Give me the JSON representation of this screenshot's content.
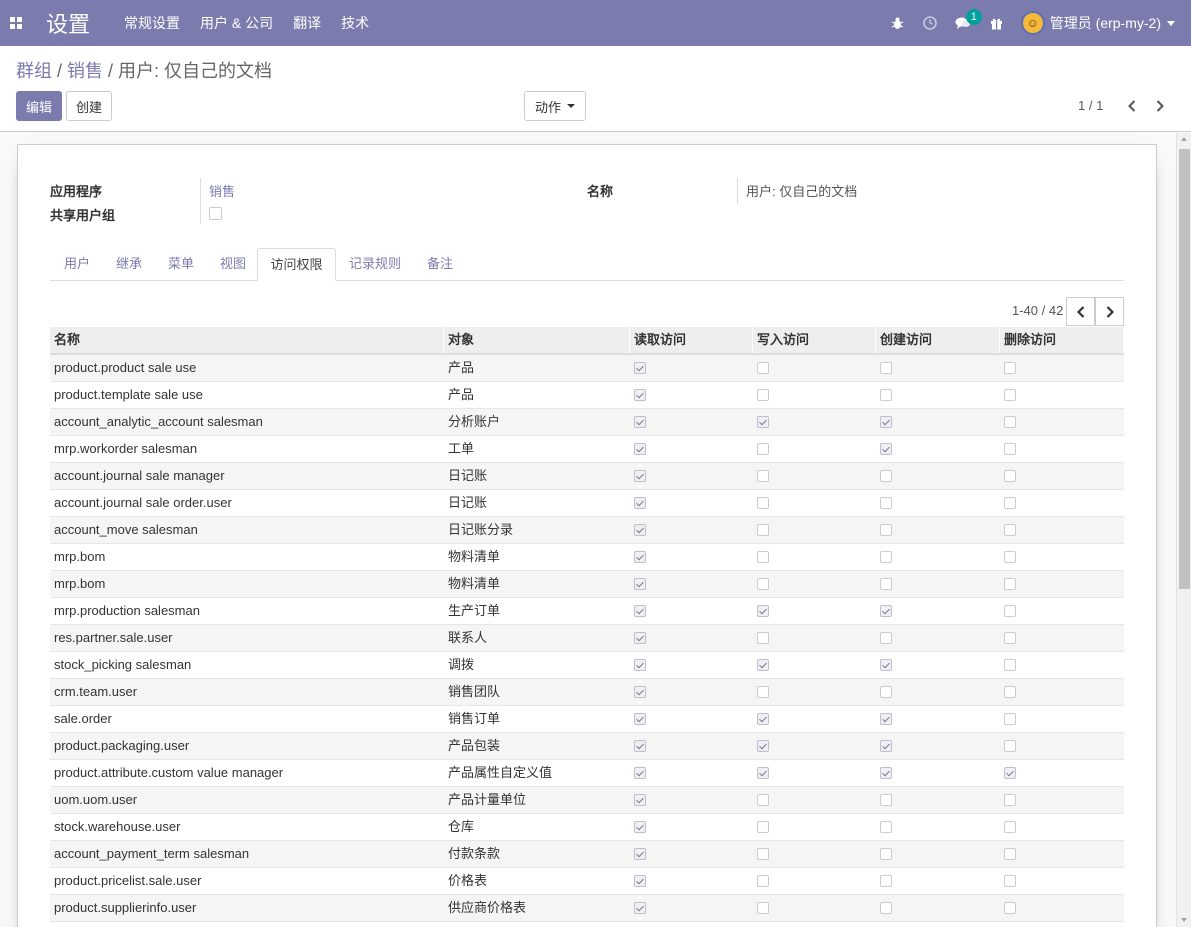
{
  "navbar": {
    "brand": "设置",
    "menu": [
      "常规设置",
      "用户 & 公司",
      "翻译",
      "技术"
    ],
    "chat_badge": "1",
    "user_name": "管理员 (erp-my-2)"
  },
  "breadcrumb": {
    "items": [
      "群组",
      "销售"
    ],
    "current": "用户: 仅自己的文档"
  },
  "buttons": {
    "edit": "编辑",
    "create": "创建",
    "action": "动作"
  },
  "pager_top": "1 / 1",
  "form": {
    "application_label": "应用程序",
    "application_value": "销售",
    "shared_group_label": "共享用户组",
    "name_label": "名称",
    "name_value": "用户: 仅自己的文档"
  },
  "tabs": [
    {
      "label": "用户",
      "active": false
    },
    {
      "label": "继承",
      "active": false
    },
    {
      "label": "菜单",
      "active": false
    },
    {
      "label": "视图",
      "active": false
    },
    {
      "label": "访问权限",
      "active": true
    },
    {
      "label": "记录规则",
      "active": false
    },
    {
      "label": "备注",
      "active": false
    }
  ],
  "list_pager": "1-40 / 42",
  "table": {
    "headers": [
      "名称",
      "对象",
      "读取访问",
      "写入访问",
      "创建访问",
      "删除访问"
    ],
    "rows": [
      {
        "name": "product.product sale use",
        "object": "产品",
        "read": true,
        "write": false,
        "create": false,
        "delete": false
      },
      {
        "name": "product.template sale use",
        "object": "产品",
        "read": true,
        "write": false,
        "create": false,
        "delete": false
      },
      {
        "name": "account_analytic_account salesman",
        "object": "分析账户",
        "read": true,
        "write": true,
        "create": true,
        "delete": false
      },
      {
        "name": "mrp.workorder salesman",
        "object": "工单",
        "read": true,
        "write": false,
        "create": true,
        "delete": false
      },
      {
        "name": "account.journal sale manager",
        "object": "日记账",
        "read": true,
        "write": false,
        "create": false,
        "delete": false
      },
      {
        "name": "account.journal sale order.user",
        "object": "日记账",
        "read": true,
        "write": false,
        "create": false,
        "delete": false
      },
      {
        "name": "account_move salesman",
        "object": "日记账分录",
        "read": true,
        "write": false,
        "create": false,
        "delete": false
      },
      {
        "name": "mrp.bom",
        "object": "物料清单",
        "read": true,
        "write": false,
        "create": false,
        "delete": false
      },
      {
        "name": "mrp.bom",
        "object": "物料清单",
        "read": true,
        "write": false,
        "create": false,
        "delete": false
      },
      {
        "name": "mrp.production salesman",
        "object": "生产订单",
        "read": true,
        "write": true,
        "create": true,
        "delete": false
      },
      {
        "name": "res.partner.sale.user",
        "object": "联系人",
        "read": true,
        "write": false,
        "create": false,
        "delete": false
      },
      {
        "name": "stock_picking salesman",
        "object": "调拨",
        "read": true,
        "write": true,
        "create": true,
        "delete": false
      },
      {
        "name": "crm.team.user",
        "object": "销售团队",
        "read": true,
        "write": false,
        "create": false,
        "delete": false
      },
      {
        "name": "sale.order",
        "object": "销售订单",
        "read": true,
        "write": true,
        "create": true,
        "delete": false
      },
      {
        "name": "product.packaging.user",
        "object": "产品包装",
        "read": true,
        "write": true,
        "create": true,
        "delete": false
      },
      {
        "name": "product.attribute.custom value manager",
        "object": "产品属性自定义值",
        "read": true,
        "write": true,
        "create": true,
        "delete": true
      },
      {
        "name": "uom.uom.user",
        "object": "产品计量单位",
        "read": true,
        "write": false,
        "create": false,
        "delete": false
      },
      {
        "name": "stock.warehouse.user",
        "object": "仓库",
        "read": true,
        "write": false,
        "create": false,
        "delete": false
      },
      {
        "name": "account_payment_term salesman",
        "object": "付款条款",
        "read": true,
        "write": false,
        "create": false,
        "delete": false
      },
      {
        "name": "product.pricelist.sale.user",
        "object": "价格表",
        "read": true,
        "write": false,
        "create": false,
        "delete": false
      },
      {
        "name": "product.supplierinfo.user",
        "object": "供应商价格表",
        "read": true,
        "write": false,
        "create": false,
        "delete": false
      }
    ]
  },
  "colors": {
    "primary": "#7c7bad",
    "badge": "#00a09d"
  }
}
